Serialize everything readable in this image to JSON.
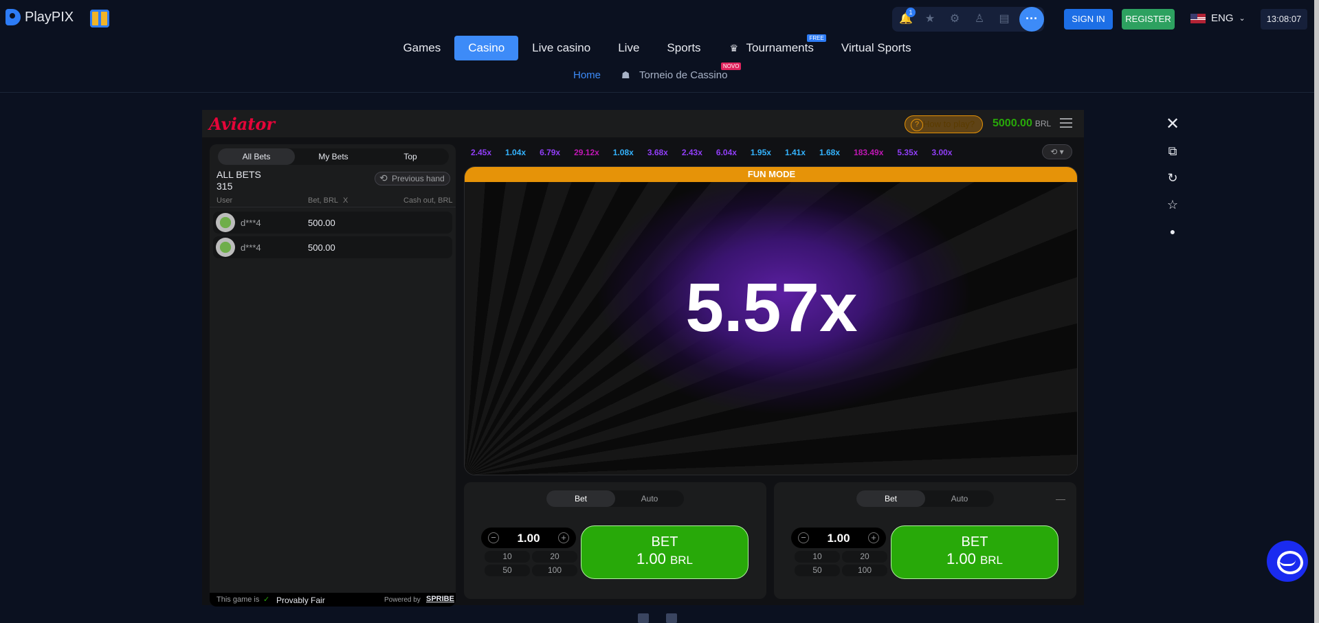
{
  "brand": {
    "name": "PlayPIX"
  },
  "topbar": {
    "notification_count": "1",
    "sign_in": "SIGN IN",
    "register": "REGISTER",
    "language": "ENG",
    "clock": "13:08:07"
  },
  "nav": {
    "items": [
      {
        "label": "Games"
      },
      {
        "label": "Casino",
        "active": true
      },
      {
        "label": "Live casino"
      },
      {
        "label": "Live"
      },
      {
        "label": "Sports"
      },
      {
        "label": "Tournaments",
        "badge": "FREE"
      },
      {
        "label": "Virtual Sports"
      }
    ]
  },
  "subnav": {
    "home": "Home",
    "torneio": "Torneio de Cassino",
    "torneio_badge": "NOVO"
  },
  "game": {
    "logo": "Aviator",
    "how_to_play": "How to play?",
    "balance": "5000.00",
    "currency": "BRL",
    "bets_panel": {
      "tabs": [
        "All Bets",
        "My Bets",
        "Top"
      ],
      "title": "ALL BETS",
      "count": "315",
      "previous_hand": "Previous hand",
      "col_user": "User",
      "col_bet": "Bet, BRL",
      "col_x": "X",
      "col_cashout": "Cash out, BRL",
      "rows": [
        {
          "user": "d***4",
          "bet": "500.00"
        },
        {
          "user": "d***4",
          "bet": "500.00"
        }
      ],
      "footer_text": "This game is",
      "provably_fair": "Provably Fair",
      "powered_by": "Powered by",
      "spribe": "SPRIBE"
    },
    "multipliers": [
      {
        "v": "2.45x",
        "c": "#913ef8"
      },
      {
        "v": "1.04x",
        "c": "#34b4ff"
      },
      {
        "v": "6.79x",
        "c": "#913ef8"
      },
      {
        "v": "29.12x",
        "c": "#c017b4"
      },
      {
        "v": "1.08x",
        "c": "#34b4ff"
      },
      {
        "v": "3.68x",
        "c": "#913ef8"
      },
      {
        "v": "2.43x",
        "c": "#913ef8"
      },
      {
        "v": "6.04x",
        "c": "#913ef8"
      },
      {
        "v": "1.95x",
        "c": "#34b4ff"
      },
      {
        "v": "1.41x",
        "c": "#34b4ff"
      },
      {
        "v": "1.68x",
        "c": "#34b4ff"
      },
      {
        "v": "183.49x",
        "c": "#c017b4"
      },
      {
        "v": "5.35x",
        "c": "#913ef8"
      },
      {
        "v": "3.00x",
        "c": "#913ef8"
      }
    ],
    "fun_mode": "FUN MODE",
    "current_multiplier": "5.57x",
    "bet_panels": [
      {
        "tab_bet": "Bet",
        "tab_auto": "Auto",
        "amount": "1.00",
        "quick": [
          "10",
          "20",
          "50",
          "100"
        ],
        "btn_label": "BET",
        "btn_amount": "1.00",
        "btn_currency": "BRL"
      },
      {
        "tab_bet": "Bet",
        "tab_auto": "Auto",
        "amount": "1.00",
        "quick": [
          "10",
          "20",
          "50",
          "100"
        ],
        "btn_label": "BET",
        "btn_amount": "1.00",
        "btn_currency": "BRL"
      }
    ]
  },
  "icons": [
    "bell-icon",
    "star-icon",
    "gear-icon",
    "award-icon",
    "list-icon",
    "more-icon",
    "close-icon",
    "popout-icon",
    "refresh-icon",
    "favorite-icon",
    "toggle-icon",
    "chat-icon"
  ]
}
